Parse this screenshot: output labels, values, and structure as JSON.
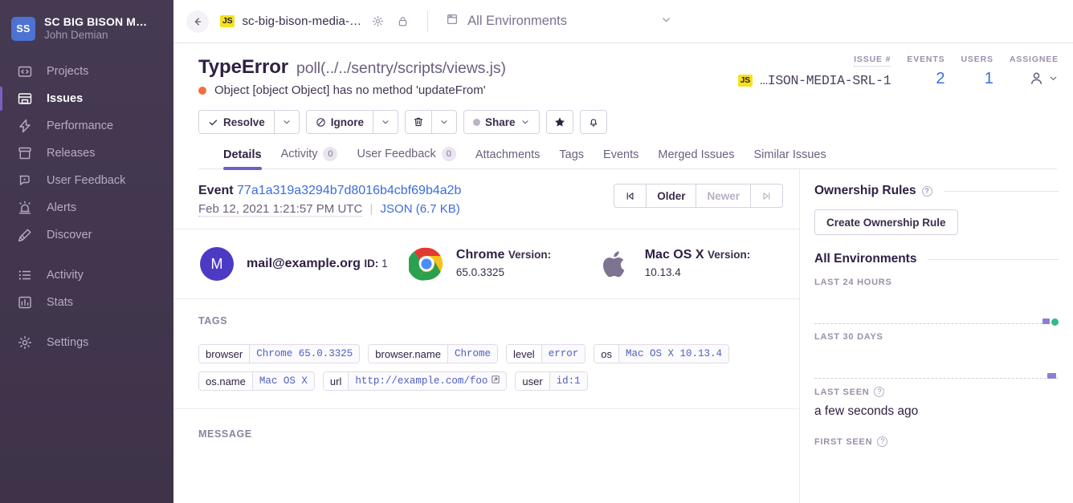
{
  "sidebar": {
    "org": {
      "initials": "SS",
      "name": "SC BIG BISON M…",
      "user": "John Demian"
    },
    "items": [
      {
        "label": "Projects",
        "icon": "projects-icon"
      },
      {
        "label": "Issues",
        "icon": "issues-icon"
      },
      {
        "label": "Performance",
        "icon": "performance-icon"
      },
      {
        "label": "Releases",
        "icon": "releases-icon"
      },
      {
        "label": "User Feedback",
        "icon": "user-feedback-icon"
      },
      {
        "label": "Alerts",
        "icon": "alerts-icon"
      },
      {
        "label": "Discover",
        "icon": "discover-icon"
      }
    ],
    "items2": [
      {
        "label": "Activity",
        "icon": "activity-icon"
      },
      {
        "label": "Stats",
        "icon": "stats-icon"
      }
    ],
    "items3": [
      {
        "label": "Settings",
        "icon": "settings-icon"
      }
    ]
  },
  "topbar": {
    "back": "←",
    "platform_badge": "JS",
    "project": "sc-big-bison-media-…",
    "environment": "All Environments"
  },
  "issue": {
    "error_type": "TypeError",
    "location": "poll(../../sentry/scripts/views.js)",
    "culprit": "Object [object Object] has no method 'updateFrom'",
    "level_color": "#f26f3f",
    "stats": {
      "issue_label": "ISSUE #",
      "issue_value": "…ISON-MEDIA-SRL-1",
      "issue_badge": "JS",
      "events_label": "EVENTS",
      "events_value": "2",
      "users_label": "USERS",
      "users_value": "1",
      "assignee_label": "ASSIGNEE"
    },
    "actions": {
      "resolve": "Resolve",
      "ignore": "Ignore",
      "share": "Share"
    }
  },
  "tabs": [
    {
      "label": "Details",
      "badge": ""
    },
    {
      "label": "Activity",
      "badge": "0"
    },
    {
      "label": "User Feedback",
      "badge": "0"
    },
    {
      "label": "Attachments",
      "badge": ""
    },
    {
      "label": "Tags",
      "badge": ""
    },
    {
      "label": "Events",
      "badge": ""
    },
    {
      "label": "Merged Issues",
      "badge": ""
    },
    {
      "label": "Similar Issues",
      "badge": ""
    }
  ],
  "event": {
    "label": "Event",
    "id": "77a1a319a3294b7d8016b4cbf69b4a2b",
    "date": "Feb 12, 2021 1:21:57 PM UTC",
    "json_link": "JSON (6.7 KB)",
    "nav": {
      "oldest": "|◁",
      "older": "Older",
      "newer": "Newer",
      "newest": "▷|"
    }
  },
  "context": {
    "user": {
      "avatar_letter": "M",
      "title": "mail@example.org",
      "sub_key": "ID:",
      "sub_val": "1"
    },
    "browser": {
      "title": "Chrome",
      "sub_key": "Version:",
      "sub_val": "65.0.3325"
    },
    "os": {
      "title": "Mac OS X",
      "sub_key": "Version:",
      "sub_val": "10.13.4"
    }
  },
  "tags_section": {
    "label": "TAGS",
    "tags": [
      {
        "key": "browser",
        "value": "Chrome 65.0.3325",
        "external": false
      },
      {
        "key": "browser.name",
        "value": "Chrome",
        "external": false
      },
      {
        "key": "level",
        "value": "error",
        "external": false
      },
      {
        "key": "os",
        "value": "Mac OS X 10.13.4",
        "external": false
      },
      {
        "key": "os.name",
        "value": "Mac OS X",
        "external": false
      },
      {
        "key": "url",
        "value": "http://example.com/foo",
        "external": true
      },
      {
        "key": "user",
        "value": "id:1",
        "external": false
      }
    ]
  },
  "message_section": {
    "label": "MESSAGE"
  },
  "side": {
    "ownership_title": "Ownership Rules",
    "create_rule_button": "Create Ownership Rule",
    "environments_title": "All Environments",
    "last_24_hours_label": "LAST 24 HOURS",
    "last_30_days_label": "LAST 30 DAYS",
    "last_seen_label": "LAST SEEN",
    "last_seen_value": "a few seconds ago",
    "first_seen_label": "FIRST SEEN"
  },
  "chart_data": [
    {
      "type": "bar",
      "title": "LAST 24 HOURS",
      "categories": [
        "0",
        "1",
        "2",
        "3",
        "4",
        "5",
        "6",
        "7",
        "8",
        "9",
        "10",
        "11",
        "12",
        "13",
        "14",
        "15",
        "16",
        "17",
        "18",
        "19",
        "20",
        "21",
        "22",
        "23"
      ],
      "values": [
        0,
        0,
        0,
        0,
        0,
        0,
        0,
        0,
        0,
        0,
        0,
        0,
        0,
        0,
        0,
        0,
        0,
        0,
        0,
        0,
        0,
        0,
        0,
        2
      ],
      "ylim": [
        0,
        2
      ],
      "marker": {
        "type": "dot",
        "color": "#33b98c",
        "at": 23
      },
      "bar_color": "#8d7fd6",
      "grid": false,
      "legend": false
    },
    {
      "type": "bar",
      "title": "LAST 30 DAYS",
      "categories": [
        "1",
        "2",
        "3",
        "4",
        "5",
        "6",
        "7",
        "8",
        "9",
        "10",
        "11",
        "12",
        "13",
        "14",
        "15",
        "16",
        "17",
        "18",
        "19",
        "20",
        "21",
        "22",
        "23",
        "24",
        "25",
        "26",
        "27",
        "28",
        "29",
        "30"
      ],
      "values": [
        0,
        0,
        0,
        0,
        0,
        0,
        0,
        0,
        0,
        0,
        0,
        0,
        0,
        0,
        0,
        0,
        0,
        0,
        0,
        0,
        0,
        0,
        0,
        0,
        0,
        0,
        0,
        0,
        0,
        2
      ],
      "ylim": [
        0,
        2
      ],
      "bar_color": "#8d7fd6",
      "grid": false,
      "legend": false
    }
  ]
}
